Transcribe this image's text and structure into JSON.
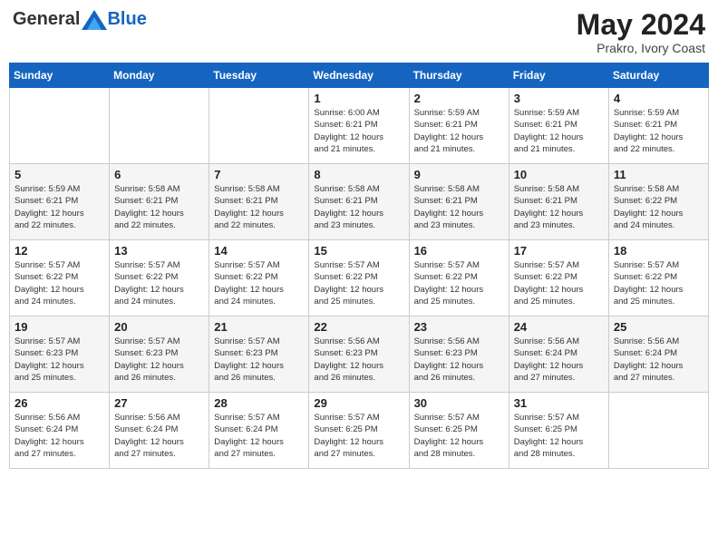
{
  "header": {
    "logo_general": "General",
    "logo_blue": "Blue",
    "title": "May 2024",
    "location": "Prakro, Ivory Coast"
  },
  "weekdays": [
    "Sunday",
    "Monday",
    "Tuesday",
    "Wednesday",
    "Thursday",
    "Friday",
    "Saturday"
  ],
  "weeks": [
    [
      {
        "day": "",
        "info": ""
      },
      {
        "day": "",
        "info": ""
      },
      {
        "day": "",
        "info": ""
      },
      {
        "day": "1",
        "info": "Sunrise: 6:00 AM\nSunset: 6:21 PM\nDaylight: 12 hours\nand 21 minutes."
      },
      {
        "day": "2",
        "info": "Sunrise: 5:59 AM\nSunset: 6:21 PM\nDaylight: 12 hours\nand 21 minutes."
      },
      {
        "day": "3",
        "info": "Sunrise: 5:59 AM\nSunset: 6:21 PM\nDaylight: 12 hours\nand 21 minutes."
      },
      {
        "day": "4",
        "info": "Sunrise: 5:59 AM\nSunset: 6:21 PM\nDaylight: 12 hours\nand 22 minutes."
      }
    ],
    [
      {
        "day": "5",
        "info": "Sunrise: 5:59 AM\nSunset: 6:21 PM\nDaylight: 12 hours\nand 22 minutes."
      },
      {
        "day": "6",
        "info": "Sunrise: 5:58 AM\nSunset: 6:21 PM\nDaylight: 12 hours\nand 22 minutes."
      },
      {
        "day": "7",
        "info": "Sunrise: 5:58 AM\nSunset: 6:21 PM\nDaylight: 12 hours\nand 22 minutes."
      },
      {
        "day": "8",
        "info": "Sunrise: 5:58 AM\nSunset: 6:21 PM\nDaylight: 12 hours\nand 23 minutes."
      },
      {
        "day": "9",
        "info": "Sunrise: 5:58 AM\nSunset: 6:21 PM\nDaylight: 12 hours\nand 23 minutes."
      },
      {
        "day": "10",
        "info": "Sunrise: 5:58 AM\nSunset: 6:21 PM\nDaylight: 12 hours\nand 23 minutes."
      },
      {
        "day": "11",
        "info": "Sunrise: 5:58 AM\nSunset: 6:22 PM\nDaylight: 12 hours\nand 24 minutes."
      }
    ],
    [
      {
        "day": "12",
        "info": "Sunrise: 5:57 AM\nSunset: 6:22 PM\nDaylight: 12 hours\nand 24 minutes."
      },
      {
        "day": "13",
        "info": "Sunrise: 5:57 AM\nSunset: 6:22 PM\nDaylight: 12 hours\nand 24 minutes."
      },
      {
        "day": "14",
        "info": "Sunrise: 5:57 AM\nSunset: 6:22 PM\nDaylight: 12 hours\nand 24 minutes."
      },
      {
        "day": "15",
        "info": "Sunrise: 5:57 AM\nSunset: 6:22 PM\nDaylight: 12 hours\nand 25 minutes."
      },
      {
        "day": "16",
        "info": "Sunrise: 5:57 AM\nSunset: 6:22 PM\nDaylight: 12 hours\nand 25 minutes."
      },
      {
        "day": "17",
        "info": "Sunrise: 5:57 AM\nSunset: 6:22 PM\nDaylight: 12 hours\nand 25 minutes."
      },
      {
        "day": "18",
        "info": "Sunrise: 5:57 AM\nSunset: 6:22 PM\nDaylight: 12 hours\nand 25 minutes."
      }
    ],
    [
      {
        "day": "19",
        "info": "Sunrise: 5:57 AM\nSunset: 6:23 PM\nDaylight: 12 hours\nand 25 minutes."
      },
      {
        "day": "20",
        "info": "Sunrise: 5:57 AM\nSunset: 6:23 PM\nDaylight: 12 hours\nand 26 minutes."
      },
      {
        "day": "21",
        "info": "Sunrise: 5:57 AM\nSunset: 6:23 PM\nDaylight: 12 hours\nand 26 minutes."
      },
      {
        "day": "22",
        "info": "Sunrise: 5:56 AM\nSunset: 6:23 PM\nDaylight: 12 hours\nand 26 minutes."
      },
      {
        "day": "23",
        "info": "Sunrise: 5:56 AM\nSunset: 6:23 PM\nDaylight: 12 hours\nand 26 minutes."
      },
      {
        "day": "24",
        "info": "Sunrise: 5:56 AM\nSunset: 6:24 PM\nDaylight: 12 hours\nand 27 minutes."
      },
      {
        "day": "25",
        "info": "Sunrise: 5:56 AM\nSunset: 6:24 PM\nDaylight: 12 hours\nand 27 minutes."
      }
    ],
    [
      {
        "day": "26",
        "info": "Sunrise: 5:56 AM\nSunset: 6:24 PM\nDaylight: 12 hours\nand 27 minutes."
      },
      {
        "day": "27",
        "info": "Sunrise: 5:56 AM\nSunset: 6:24 PM\nDaylight: 12 hours\nand 27 minutes."
      },
      {
        "day": "28",
        "info": "Sunrise: 5:57 AM\nSunset: 6:24 PM\nDaylight: 12 hours\nand 27 minutes."
      },
      {
        "day": "29",
        "info": "Sunrise: 5:57 AM\nSunset: 6:25 PM\nDaylight: 12 hours\nand 27 minutes."
      },
      {
        "day": "30",
        "info": "Sunrise: 5:57 AM\nSunset: 6:25 PM\nDaylight: 12 hours\nand 28 minutes."
      },
      {
        "day": "31",
        "info": "Sunrise: 5:57 AM\nSunset: 6:25 PM\nDaylight: 12 hours\nand 28 minutes."
      },
      {
        "day": "",
        "info": ""
      }
    ]
  ]
}
